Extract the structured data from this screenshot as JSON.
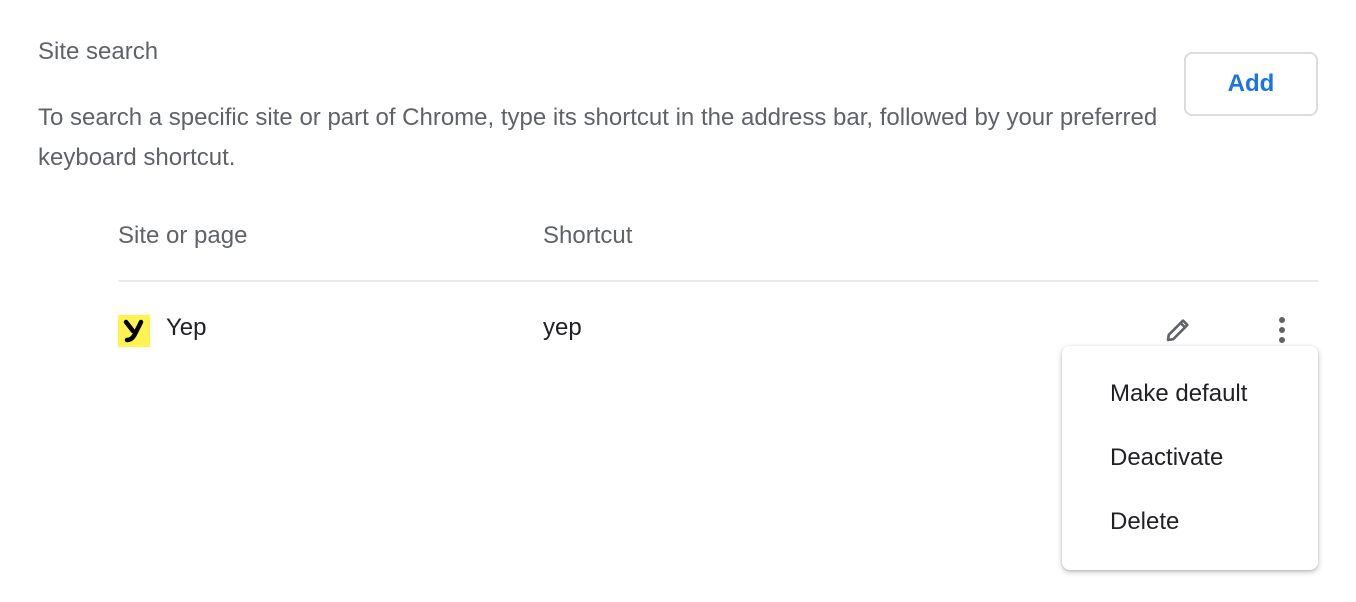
{
  "section": {
    "title": "Site search",
    "description": "To search a specific site or part of Chrome, type its shortcut in the address bar, followed by your preferred keyboard shortcut.",
    "add_label": "Add"
  },
  "table": {
    "headers": {
      "site": "Site or page",
      "shortcut": "Shortcut"
    },
    "rows": [
      {
        "site": "Yep",
        "shortcut": "yep",
        "icon": "yep-favicon"
      }
    ]
  },
  "row_actions": {
    "edit_icon": "pencil-icon",
    "more_icon": "more-vert-icon"
  },
  "context_menu": {
    "items": [
      {
        "label": "Make default"
      },
      {
        "label": "Deactivate"
      },
      {
        "label": "Delete"
      }
    ]
  },
  "colors": {
    "accent": "#1a73e8",
    "text_primary": "#202124",
    "text_secondary": "#5f6368",
    "favicon_bg": "#fff44f"
  }
}
